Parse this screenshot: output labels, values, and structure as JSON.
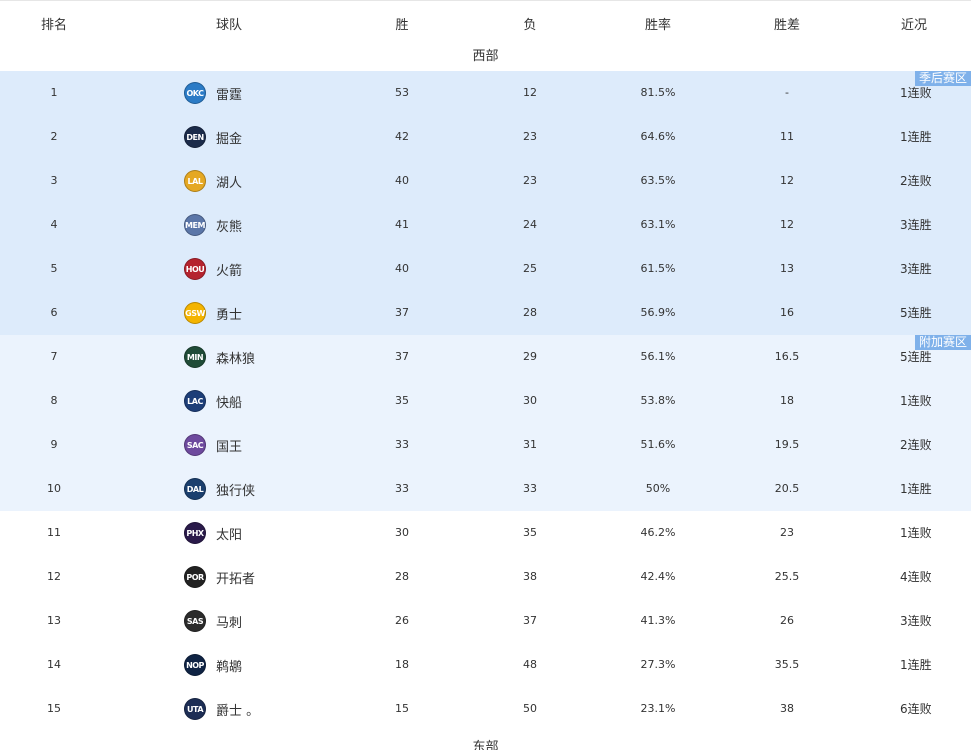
{
  "columns": {
    "rank": "排名",
    "team": "球队",
    "wins": "胜",
    "losses": "负",
    "pct": "胜率",
    "gb": "胜差",
    "streak": "近况"
  },
  "conference": "西部",
  "next_conference": "东部",
  "zone_labels": {
    "playoff": "季后赛区",
    "playin": "附加赛区"
  },
  "rows": [
    {
      "rank": "1",
      "abbr": "OKC",
      "team": "雷霆",
      "wins": "53",
      "losses": "12",
      "pct": "81.5%",
      "gb": "-",
      "streak": "1连败",
      "zone": "playoff",
      "color": "#2b7bc6"
    },
    {
      "rank": "2",
      "abbr": "DEN",
      "team": "掘金",
      "wins": "42",
      "losses": "23",
      "pct": "64.6%",
      "gb": "11",
      "streak": "1连胜",
      "zone": "playoff",
      "color": "#1b2b4a"
    },
    {
      "rank": "3",
      "abbr": "LAL",
      "team": "湖人",
      "wins": "40",
      "losses": "23",
      "pct": "63.5%",
      "gb": "12",
      "streak": "2连败",
      "zone": "playoff",
      "color": "#e5a823"
    },
    {
      "rank": "4",
      "abbr": "MEM",
      "team": "灰熊",
      "wins": "41",
      "losses": "24",
      "pct": "63.1%",
      "gb": "12",
      "streak": "3连胜",
      "zone": "playoff",
      "color": "#5b76a8"
    },
    {
      "rank": "5",
      "abbr": "HOU",
      "team": "火箭",
      "wins": "40",
      "losses": "25",
      "pct": "61.5%",
      "gb": "13",
      "streak": "3连胜",
      "zone": "playoff",
      "color": "#b5232e"
    },
    {
      "rank": "6",
      "abbr": "GSW",
      "team": "勇士",
      "wins": "37",
      "losses": "28",
      "pct": "56.9%",
      "gb": "16",
      "streak": "5连胜",
      "zone": "playoff",
      "color": "#f4b400"
    },
    {
      "rank": "7",
      "abbr": "MIN",
      "team": "森林狼",
      "wins": "37",
      "losses": "29",
      "pct": "56.1%",
      "gb": "16.5",
      "streak": "5连胜",
      "zone": "playin",
      "color": "#1f4b37"
    },
    {
      "rank": "8",
      "abbr": "LAC",
      "team": "快船",
      "wins": "35",
      "losses": "30",
      "pct": "53.8%",
      "gb": "18",
      "streak": "1连败",
      "zone": "playin",
      "color": "#1d3e78"
    },
    {
      "rank": "9",
      "abbr": "SAC",
      "team": "国王",
      "wins": "33",
      "losses": "31",
      "pct": "51.6%",
      "gb": "19.5",
      "streak": "2连败",
      "zone": "playin",
      "color": "#6e4a9e"
    },
    {
      "rank": "10",
      "abbr": "DAL",
      "team": "独行侠",
      "wins": "33",
      "losses": "33",
      "pct": "50%",
      "gb": "20.5",
      "streak": "1连胜",
      "zone": "playin",
      "color": "#1b3f6e"
    },
    {
      "rank": "11",
      "abbr": "PHX",
      "team": "太阳",
      "wins": "30",
      "losses": "35",
      "pct": "46.2%",
      "gb": "23",
      "streak": "1连败",
      "zone": "normal",
      "color": "#2a1a4a"
    },
    {
      "rank": "12",
      "abbr": "POR",
      "team": "开拓者",
      "wins": "28",
      "losses": "38",
      "pct": "42.4%",
      "gb": "25.5",
      "streak": "4连败",
      "zone": "normal",
      "color": "#222222"
    },
    {
      "rank": "13",
      "abbr": "SAS",
      "team": "马刺",
      "wins": "26",
      "losses": "37",
      "pct": "41.3%",
      "gb": "26",
      "streak": "3连败",
      "zone": "normal",
      "color": "#2b2b2b"
    },
    {
      "rank": "14",
      "abbr": "NOP",
      "team": "鹈鹕",
      "wins": "18",
      "losses": "48",
      "pct": "27.3%",
      "gb": "35.5",
      "streak": "1连胜",
      "zone": "normal",
      "color": "#0f2344"
    },
    {
      "rank": "15",
      "abbr": "UTA",
      "team": "爵士 。",
      "wins": "15",
      "losses": "50",
      "pct": "23.1%",
      "gb": "38",
      "streak": "6连败",
      "zone": "normal",
      "color": "#1d2e55"
    }
  ]
}
